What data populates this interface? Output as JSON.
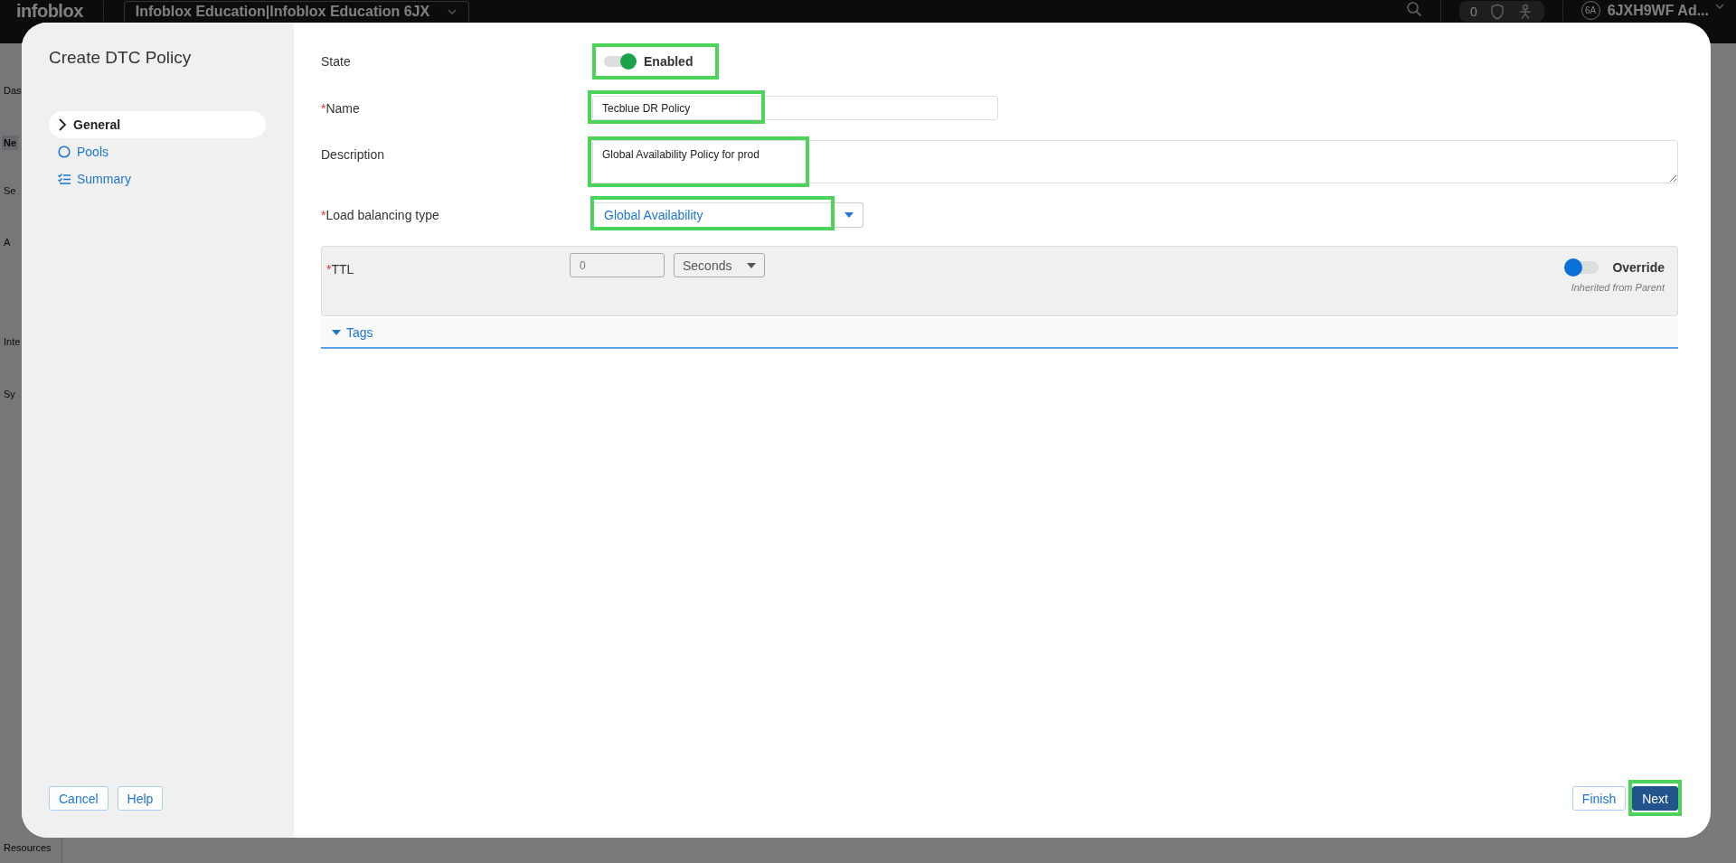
{
  "app_header": {
    "logo": "infoblox",
    "org_selector": "Infoblox Education|Infoblox Education 6JX",
    "notification_count": "0",
    "avatar": "6A",
    "user": "6JXH9WF Ad..."
  },
  "app_sidebar": {
    "items": [
      {
        "label": "Das",
        "selected": false
      },
      {
        "label": "Ne",
        "selected": true
      },
      {
        "label": "Se",
        "selected": false
      },
      {
        "label": "A",
        "selected": false
      },
      {
        "label": "Inte",
        "selected": false
      },
      {
        "label": "Sy",
        "selected": false
      },
      {
        "label": "Resources",
        "selected": false
      }
    ]
  },
  "dialog": {
    "title": "Create DTC Policy",
    "steps": [
      {
        "label": "General",
        "kind": "chevron",
        "selected": true
      },
      {
        "label": "Pools",
        "kind": "circle",
        "selected": false
      },
      {
        "label": "Summary",
        "kind": "checklist",
        "selected": false
      }
    ],
    "state": {
      "label": "State",
      "on": true,
      "value": "Enabled",
      "highlighted": true
    },
    "name": {
      "label": "Name",
      "required_mark": "*",
      "value": "Tecblue DR Policy",
      "highlighted": true
    },
    "description": {
      "label": "Description",
      "value": "Global Availability Policy for prod",
      "highlighted": true
    },
    "load_balancing_type": {
      "label": "Load balancing type",
      "required_mark": "*",
      "value": "Global Availability",
      "highlighted": true
    },
    "ttl": {
      "label": "TTL",
      "required_mark": "*",
      "value": "0",
      "unit": "Seconds",
      "override": {
        "label": "Override",
        "on": false,
        "note": "Inherited from Parent"
      }
    },
    "tags": {
      "label": "Tags",
      "expanded": true
    },
    "left_buttons": [
      {
        "label": "Cancel",
        "primary": false,
        "highlighted": false
      },
      {
        "label": "Help",
        "primary": false,
        "highlighted": false
      }
    ],
    "right_buttons": [
      {
        "label": "Finish",
        "primary": false,
        "highlighted": false
      },
      {
        "label": "Next",
        "primary": true,
        "highlighted": true
      }
    ]
  }
}
